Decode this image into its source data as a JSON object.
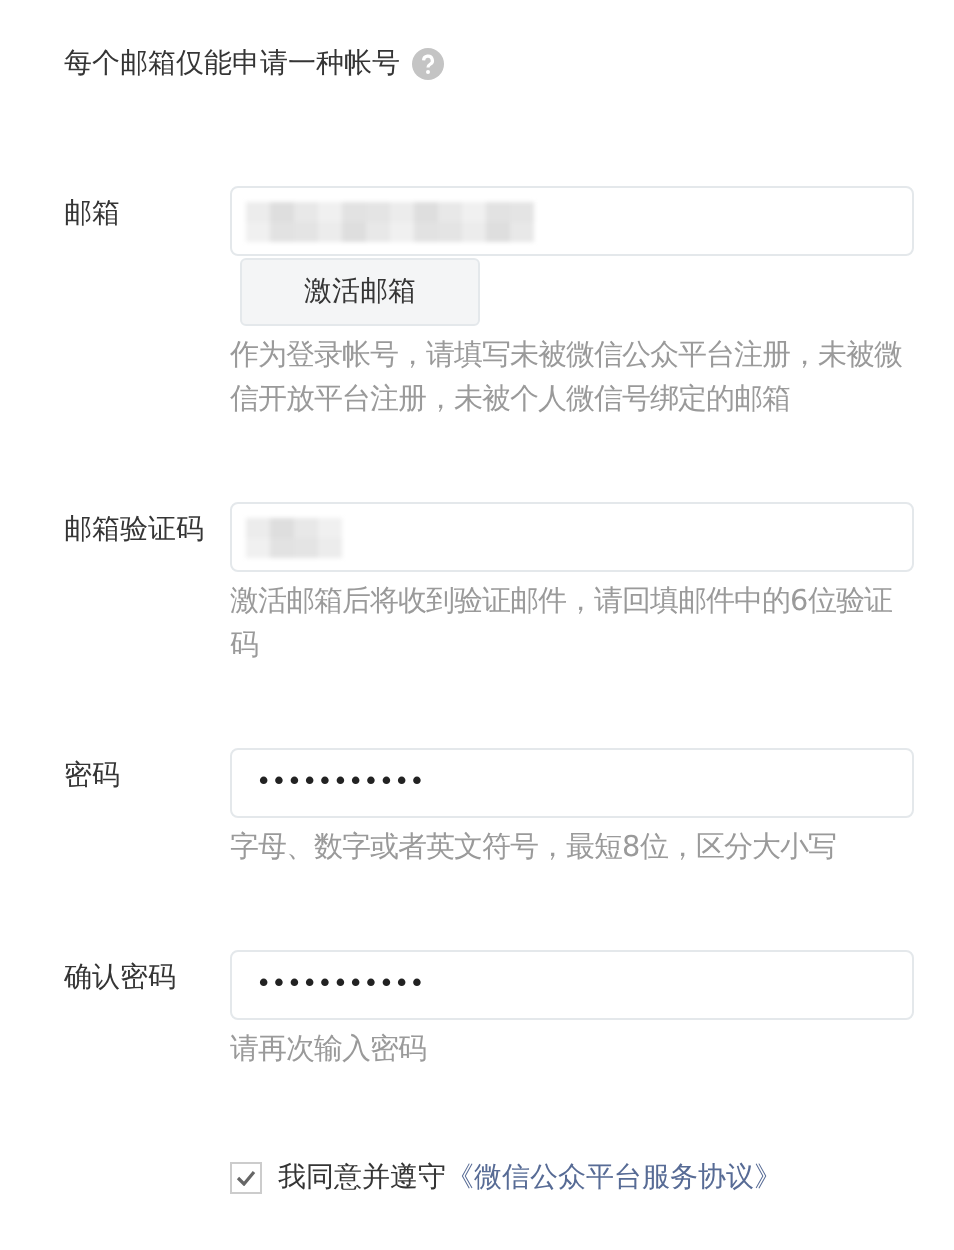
{
  "notice": {
    "text": "每个邮箱仅能申请一种帐号"
  },
  "fields": [
    {
      "label": "邮箱",
      "kind": "redacted",
      "button": "激活邮箱",
      "hint": "作为登录帐号，请填写未被微信公众平台注册，未被微信开放平台注册，未被个人微信号绑定的邮箱"
    },
    {
      "label": "邮箱验证码",
      "kind": "redacted-short",
      "hint": "激活邮箱后将收到验证邮件，请回填邮件中的6位验证码"
    },
    {
      "label": "密码",
      "kind": "password",
      "value": "•••••••••••",
      "hint": "字母、数字或者英文符号，最短8位，区分大小写"
    },
    {
      "label": "确认密码",
      "kind": "password",
      "value": "•••••••••••",
      "hint": "请再次输入密码"
    }
  ],
  "agreement": {
    "checked": true,
    "text": "我同意并遵守",
    "link": "《微信公众平台服务协议》"
  }
}
